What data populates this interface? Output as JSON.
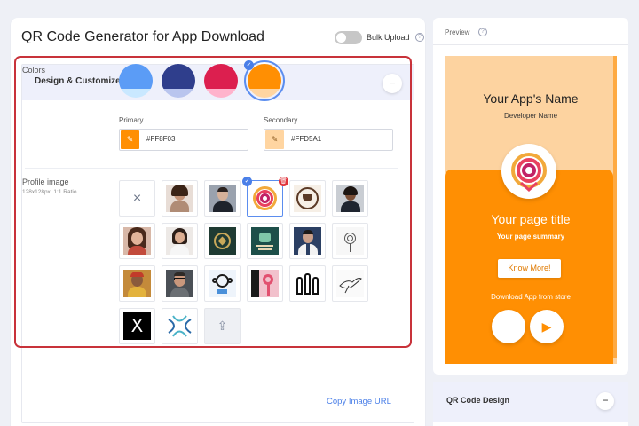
{
  "header": {
    "title": "QR Code Generator for App Download",
    "bulk_upload_label": "Bulk Upload",
    "help_glyph": "?"
  },
  "design_section": {
    "title": "Design & Customize",
    "collapse_glyph": "−"
  },
  "colors": {
    "label": "Colors",
    "swatches": [
      {
        "top": "#5b9cf6",
        "bottom": "#c9e8ff",
        "selected": false
      },
      {
        "top": "#2f3e8c",
        "bottom": "#b9c5ee",
        "selected": false
      },
      {
        "top": "#dc1f4f",
        "bottom": "#ffb3cc",
        "selected": false
      },
      {
        "top": "#ff8f03",
        "bottom": "#ffd5a1",
        "selected": true
      }
    ],
    "primary_label": "Primary",
    "primary_value": "#FF8F03",
    "secondary_label": "Secondary",
    "secondary_value": "#FFD5A1",
    "check_glyph": "✓",
    "pencil_glyph": "✎"
  },
  "profile_image": {
    "label": "Profile image",
    "sublabel": "128x128px, 1:1 Ratio",
    "remove_glyph": "×",
    "delete_glyph": "🗑",
    "upload_glyph": "⇪",
    "thumbnails": [
      {
        "name": "none-option",
        "bg": "#ffffff"
      },
      {
        "name": "woman-portrait-1",
        "bg": "#e8ddd6"
      },
      {
        "name": "man-suit-portrait",
        "bg": "#9aa2ae"
      },
      {
        "name": "orange-app-logo",
        "bg": "#ffffff",
        "selected": true
      },
      {
        "name": "coffee-logo",
        "bg": "#f6efe6"
      },
      {
        "name": "woman-portrait-2",
        "bg": "#c9cdd3"
      },
      {
        "name": "woman-portrait-3",
        "bg": "#d8b8a8"
      },
      {
        "name": "woman-portrait-4",
        "bg": "#ede9e6"
      },
      {
        "name": "green-gold-logo",
        "bg": "#1f3b33"
      },
      {
        "name": "teal-service-logo",
        "bg": "#1d4f4a"
      },
      {
        "name": "man-portrait-blue",
        "bg": "#2b3f63"
      },
      {
        "name": "floral-lineart",
        "bg": "#f7f7f7"
      },
      {
        "name": "man-yellow-portrait",
        "bg": "#c48a3a"
      },
      {
        "name": "man-glasses-portrait",
        "bg": "#4b5056"
      },
      {
        "name": "monkey-logo",
        "bg": "#eef4fb"
      },
      {
        "name": "flamingo-logo",
        "bg": "#f2c1cc"
      },
      {
        "name": "raised-hands-icon",
        "bg": "#ffffff"
      },
      {
        "name": "bird-sketch",
        "bg": "#fafafa"
      },
      {
        "name": "x-logo",
        "bg": "#000000"
      },
      {
        "name": "arrows-logo",
        "bg": "#ffffff"
      },
      {
        "name": "upload-image",
        "bg": "#eef0f4"
      }
    ]
  },
  "copy_image_url": "Copy Image URL",
  "preview": {
    "label": "Preview",
    "app_name": "Your App's Name",
    "developer_name": "Developer Name",
    "page_title": "Your page title",
    "page_summary": "Your page summary",
    "know_more": "Know More!",
    "download_text": "Download App from store",
    "apple_glyph": "",
    "play_glyph": "▶"
  },
  "qr_section": {
    "title": "QR Code Design",
    "collapse_glyph": "−"
  }
}
